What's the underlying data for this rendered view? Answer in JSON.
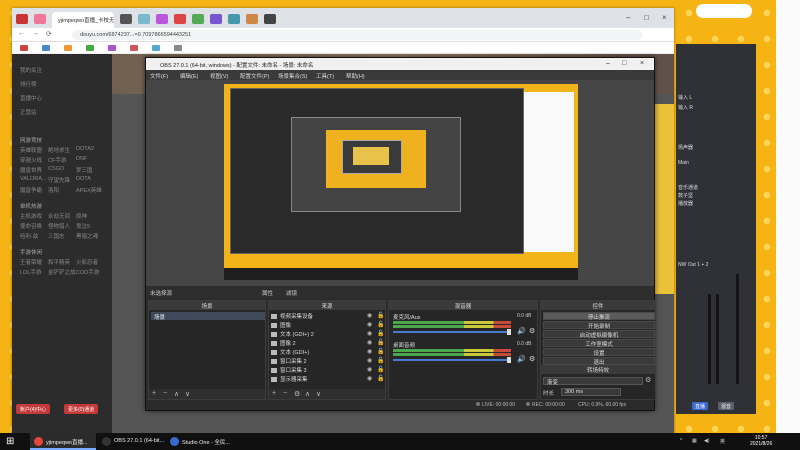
{
  "browser": {
    "tab_title": "yjimpeqwo直播_卡枝无间游戏",
    "url": "douyu.com/6874237...=0.7097866594443251",
    "page_brand": "斗鱼"
  },
  "douyu_sidebar": {
    "top_links": [
      "我的关注",
      "排行榜",
      "直播中心",
      "正营站"
    ],
    "group1_title": "网游竞技",
    "group1": [
      [
        "英雄联盟",
        "绝地求生",
        "DOTA2"
      ],
      [
        "穿越火线",
        "CF手游",
        "DNF"
      ],
      [
        "魔兽世界",
        "CSGO",
        "梦三国"
      ],
      [
        "VALORA...",
        "守望先锋",
        "DOTA"
      ],
      [
        "魔兽争霸",
        "洛阳",
        "APEX英雄"
      ]
    ],
    "group2_title": "单机热游",
    "group2": [
      [
        "主机游戏",
        "永劫无间",
        "原神"
      ],
      [
        "使命召唤",
        "怪物猎人",
        "鬼泣5"
      ],
      [
        "哈利·兹",
        "三国志",
        "黑暗之魂"
      ]
    ],
    "group3_title": "手游休闲",
    "group3": [
      [
        "王者荣耀",
        "和平精英",
        "火影忍者"
      ],
      [
        "LOL手游",
        "金铲铲之战",
        "COD手游"
      ]
    ],
    "btn_left": "账户(4)中心",
    "btn_right": "更多(0)通道"
  },
  "obs": {
    "title": "OBS 27.0.1 (64-bit, windows) - 配置文件: 未命名 - 场景: 未命名",
    "menu": [
      "文件(F)",
      "编辑(E)",
      "视图(V)",
      "配置文件(P)",
      "场景集合(S)",
      "工具(T)",
      "帮助(H)"
    ],
    "scene_bar_label": "未选择源",
    "props_label": "属性",
    "filters_label": "滤镜",
    "scenes": {
      "header": "场景",
      "items": [
        "场景"
      ]
    },
    "sources": {
      "header": "来源",
      "items": [
        "视频采集设备",
        "图像",
        "文本 (GDI+) 2",
        "图像 2",
        "文本 (GDI+)",
        "窗口采集 2",
        "窗口采集 3",
        "显示器采集"
      ]
    },
    "mixer": {
      "header": "混音器",
      "channels": [
        {
          "name": "麦克风/Aux",
          "db": "0.0 dB"
        },
        {
          "name": "桌面音频",
          "db": "0.0 dB"
        }
      ]
    },
    "controls": {
      "header": "控件",
      "buttons": [
        "停止推流",
        "开始录制",
        "启动虚拟摄像机",
        "工作室模式",
        "设置",
        "退出"
      ]
    },
    "transitions": {
      "header": "转场特效",
      "type": "渐变",
      "duration_label": "时长",
      "duration": "300 ms"
    },
    "status": {
      "live": "LIVE: 00:00:00",
      "rec": "REC: 00:00:00",
      "cpu": "CPU: 0.9%, 60.00 fps"
    }
  },
  "studio_one": {
    "labels": [
      "输入 L",
      "输入 R",
      "扬声器",
      "Main",
      "音乐通道",
      "鼓子坚",
      "播放器",
      "NW Out 1 + 2"
    ],
    "btn_a": "直播",
    "btn_b": "混音"
  },
  "taskbar": {
    "items": [
      {
        "label": "yjimpeqwo直播...",
        "color": "#e8463a"
      },
      {
        "label": "OBS 27.0.1 (64-bit...",
        "color": "#333"
      },
      {
        "label": "Studio One - 全民...",
        "color": "#3a6ad0"
      }
    ],
    "tray_lang": "英",
    "time": "10:57",
    "date": "2021/8/26"
  },
  "colors": {
    "desktop": "#f6b414",
    "obs_bg": "#2b2b2b",
    "accent_blue": "#4a7ad0"
  }
}
